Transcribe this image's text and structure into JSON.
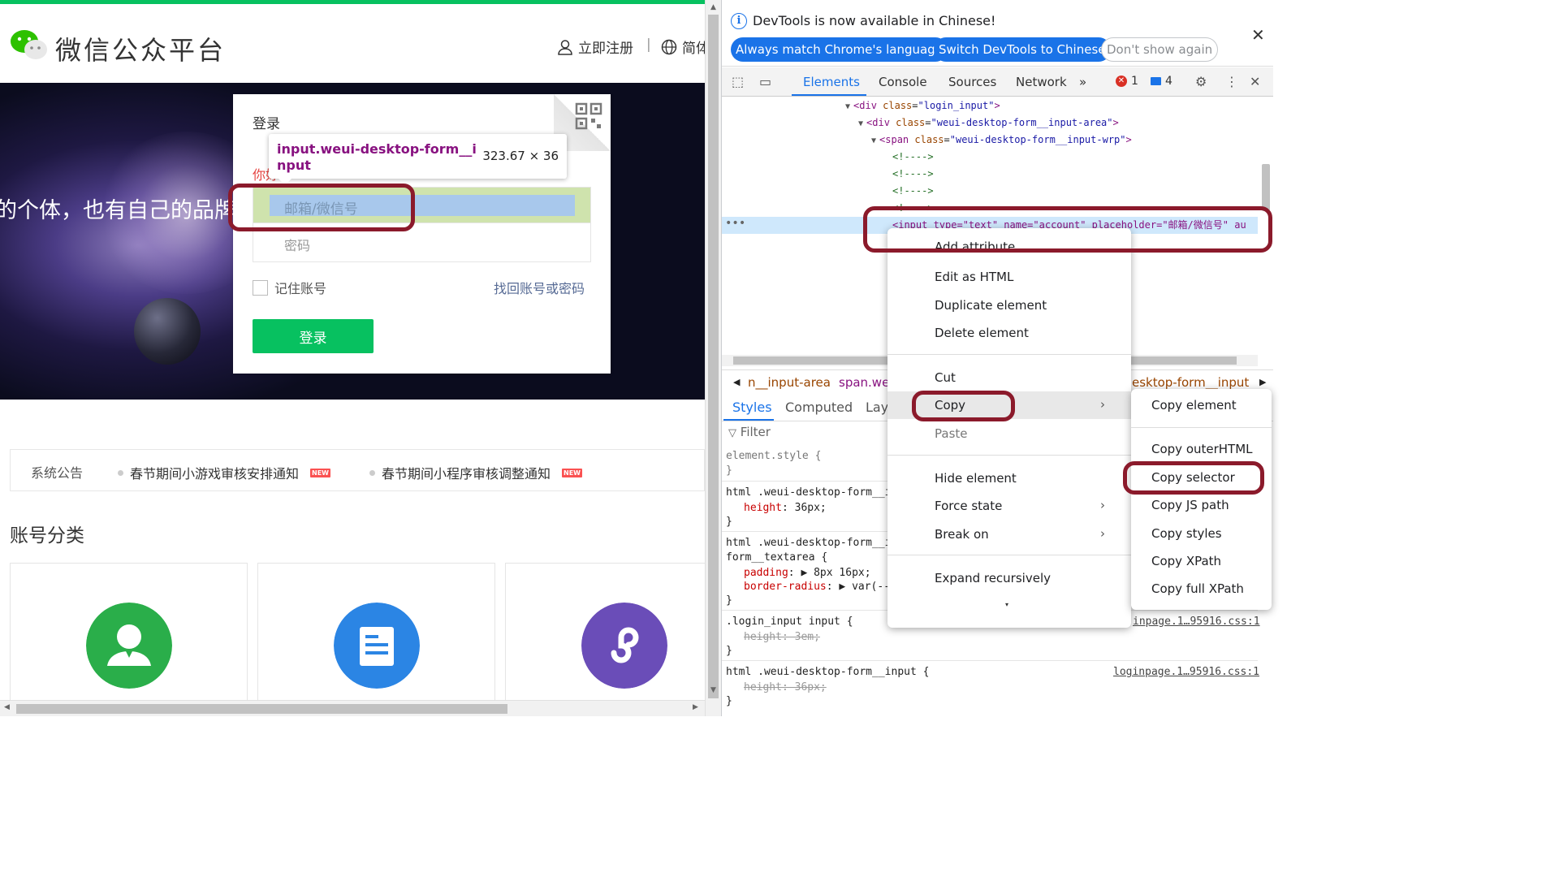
{
  "site": {
    "brand": "微信公众平台",
    "register": "立即注册",
    "separator": "|",
    "language": "简体中文",
    "banner_text": "的个体，也有自己的品牌"
  },
  "login": {
    "title": "登录",
    "hint": "你好",
    "account_placeholder": "邮箱/微信号",
    "password_placeholder": "密码",
    "remember": "记住账号",
    "forgot": "找回账号或密码",
    "button": "登录"
  },
  "inspect_tooltip": {
    "selector": "input.weui-desktop-form__input",
    "size": "323.67 × 36"
  },
  "notices": {
    "title": "系统公告",
    "badge": "NEW",
    "items": [
      "春节期间小游戏审核安排通知",
      "春节期间小程序审核调整通知"
    ]
  },
  "categories": {
    "title": "账号分类",
    "colors": [
      "#2aae4a",
      "#2b85e4",
      "#6a4db8"
    ]
  },
  "devtools": {
    "info": {
      "message": "DevTools is now available in Chinese!",
      "always_match": "Always match Chrome's language",
      "switch": "Switch DevTools to Chinese",
      "dont_show": "Don't show again",
      "close": "✕"
    },
    "tabs": [
      "Elements",
      "Console",
      "Sources",
      "Network"
    ],
    "more_tabs": "»",
    "errors": "1",
    "messages": "4",
    "dom": [
      {
        "tag": "div",
        "attr": "class",
        "value": "login_input"
      },
      {
        "tag": "div",
        "attr": "class",
        "value": "weui-desktop-form__input-area"
      },
      {
        "tag": "span",
        "attr": "class",
        "value": "weui-desktop-form__input-wrp"
      },
      {
        "comment": "<!---->"
      },
      {
        "comment": "<!---->"
      },
      {
        "comment": "<!---->"
      },
      {
        "comment": "<!---->"
      },
      {
        "selected": "<input type=\"text\" name=\"account\" placeholder=\"邮箱/微信号\" au"
      }
    ],
    "breadcrumbs": [
      "n__input-area",
      "span.weu",
      "esktop-form__input"
    ],
    "styles_tabs": [
      "Styles",
      "Computed",
      "Layo"
    ],
    "filter": "Filter",
    "styles": {
      "element_style": "element.style {",
      "close_brace": "}",
      "rule1_selector": "html .weui-desktop-form__in",
      "rule1_prop": "height",
      "rule1_val": "36px;",
      "rule2_selector": "html .weui-desktop-form__in",
      "rule2_selector_b": "form__textarea {",
      "rule2_prop1": "padding",
      "rule2_val1": "8px 16px;",
      "rule2_prop2": "border-radius",
      "rule2_val2": "var(--w",
      "rule3_selector": ".login_input input {",
      "rule3_decl": "height: 3em;",
      "rule3_src": "inpage.1…95916.css:1",
      "rule4_selector": "html .weui-desktop-form__input {",
      "rule4_decl": "height: 36px;",
      "rule4_src": "loginpage.1…95916.css:1"
    },
    "context_menu": {
      "items": [
        "Add attribute",
        "Edit as HTML",
        "Duplicate element",
        "Delete element",
        "Cut",
        "Copy",
        "Paste",
        "Hide element",
        "Force state",
        "Break on",
        "Expand recursively"
      ],
      "more": "▾"
    },
    "copy_submenu": [
      "Copy element",
      "Copy outerHTML",
      "Copy selector",
      "Copy JS path",
      "Copy styles",
      "Copy XPath",
      "Copy full XPath"
    ]
  }
}
